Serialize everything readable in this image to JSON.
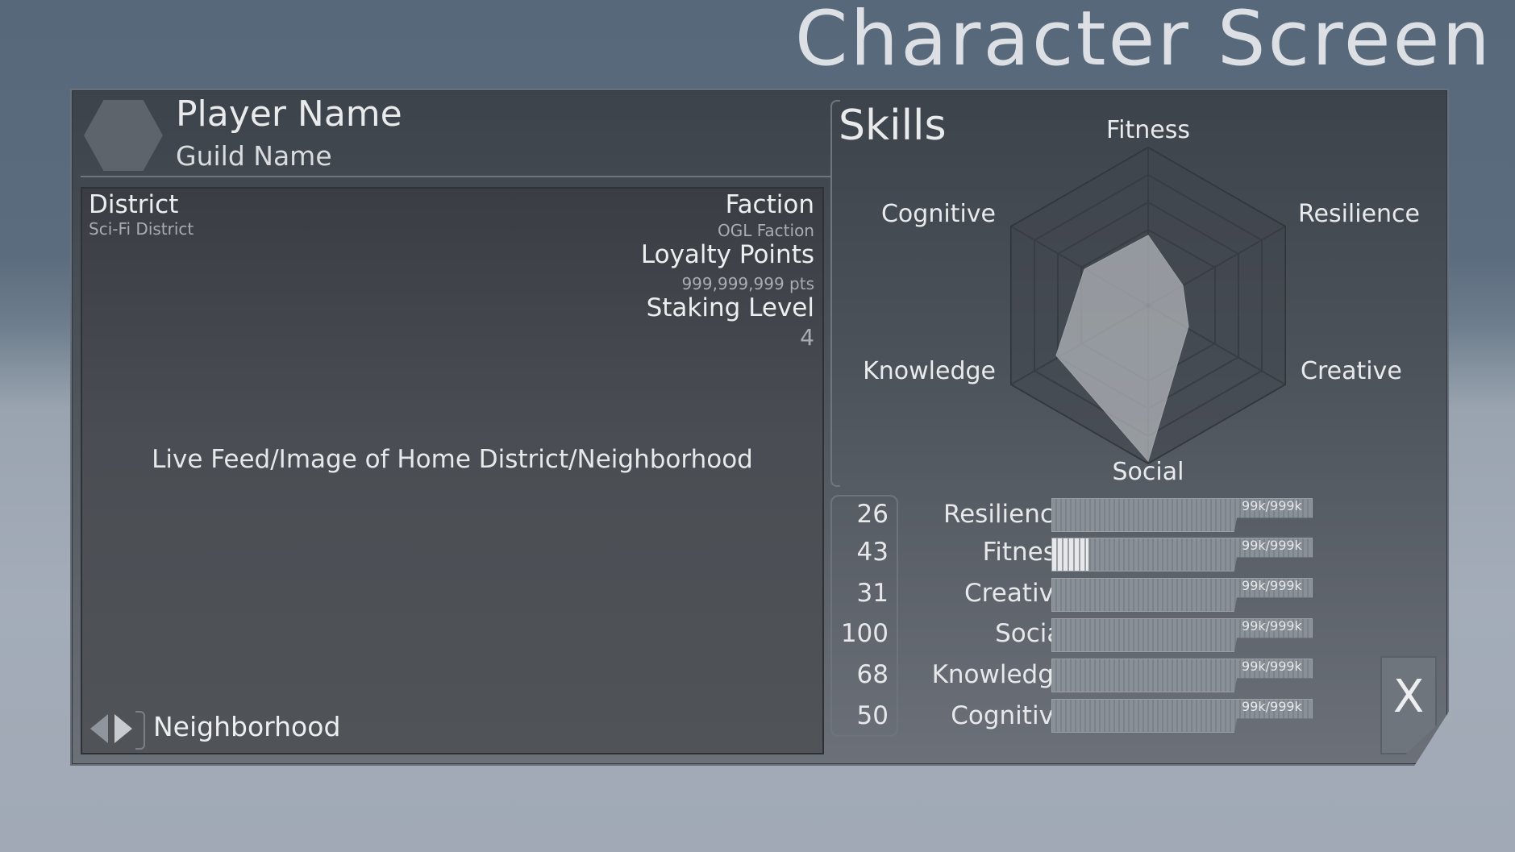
{
  "screen": {
    "title": "Character Screen"
  },
  "header": {
    "player_name": "Player Name",
    "guild_name": "Guild Name"
  },
  "feed": {
    "district_label": "District",
    "district_value": "Sci-Fi District",
    "faction_label": "Faction",
    "faction_value": "OGL Faction",
    "loyalty_label": "Loyalty Points",
    "loyalty_value": "999,999,999 pts",
    "staking_label": "Staking Level",
    "staking_value": "4",
    "live_text": "Live Feed/Image of Home District/Neighborhood",
    "neighborhood_label": "Neighborhood"
  },
  "skills": {
    "title": "Skills",
    "axes": [
      "Fitness",
      "Resilience",
      "Creative",
      "Social",
      "Knowledge",
      "Cognitive"
    ]
  },
  "stats": [
    {
      "value": "26",
      "name": "Resilience",
      "bar_text": "99k/999k",
      "fill": 0
    },
    {
      "value": "43",
      "name": "Fitness",
      "bar_text": "99k/999k",
      "fill": 0.14
    },
    {
      "value": "31",
      "name": "Creative",
      "bar_text": "99k/999k",
      "fill": 0
    },
    {
      "value": "100",
      "name": "Social",
      "bar_text": "99k/999k",
      "fill": 0
    },
    {
      "value": "68",
      "name": "Knowledge",
      "bar_text": "99k/999k",
      "fill": 0
    },
    {
      "value": "50",
      "name": "Cognitive",
      "bar_text": "99k/999k",
      "fill": 0
    }
  ],
  "close_button": {
    "label": "X"
  }
}
